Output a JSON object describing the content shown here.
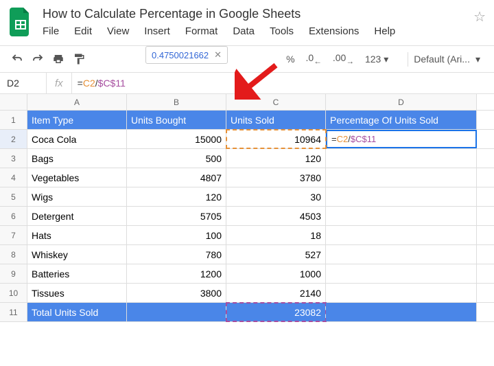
{
  "doc_title": "How to Calculate Percentage in Google Sheets",
  "menu": {
    "file": "File",
    "edit": "Edit",
    "view": "View",
    "insert": "Insert",
    "format": "Format",
    "data": "Data",
    "tools": "Tools",
    "extensions": "Extensions",
    "help": "Help"
  },
  "tooltip_value": "0.4750021662",
  "toolbar": {
    "percent": "%",
    "dec_dec": ".0",
    "inc_dec": ".00",
    "num_fmt": "123",
    "font": "Default (Ari..."
  },
  "active_cell": "D2",
  "fx_label": "fx",
  "formula": {
    "eq": "=",
    "ref1": "C2",
    "op": "/",
    "ref2": "$C$11"
  },
  "cols": {
    "A": "A",
    "B": "B",
    "C": "C",
    "D": "D"
  },
  "headers": {
    "item": "Item Type",
    "bought": "Units Bought",
    "sold": "Units Sold",
    "pct": "Percentage Of Units Sold"
  },
  "rows": [
    {
      "n": "2",
      "item": "Coca Cola",
      "bought": "15000",
      "sold": "10964"
    },
    {
      "n": "3",
      "item": "Bags",
      "bought": "500",
      "sold": "120"
    },
    {
      "n": "4",
      "item": "Vegetables",
      "bought": "4807",
      "sold": "3780"
    },
    {
      "n": "5",
      "item": "Wigs",
      "bought": "120",
      "sold": "30"
    },
    {
      "n": "6",
      "item": "Detergent",
      "bought": "5705",
      "sold": "4503"
    },
    {
      "n": "7",
      "item": "Hats",
      "bought": "100",
      "sold": "18"
    },
    {
      "n": "8",
      "item": "Whiskey",
      "bought": "780",
      "sold": "527"
    },
    {
      "n": "9",
      "item": "Batteries",
      "bought": "1200",
      "sold": "1000"
    },
    {
      "n": "10",
      "item": "Tissues",
      "bought": "3800",
      "sold": "2140"
    }
  ],
  "total": {
    "n": "11",
    "label": "Total Units Sold",
    "sold": "23082"
  },
  "chart_data": {
    "type": "table",
    "title": "How to Calculate Percentage in Google Sheets",
    "columns": [
      "Item Type",
      "Units Bought",
      "Units Sold",
      "Percentage Of Units Sold"
    ],
    "rows": [
      [
        "Coca Cola",
        15000,
        10964,
        0.4750021662
      ],
      [
        "Bags",
        500,
        120,
        null
      ],
      [
        "Vegetables",
        4807,
        3780,
        null
      ],
      [
        "Wigs",
        120,
        30,
        null
      ],
      [
        "Detergent",
        5705,
        4503,
        null
      ],
      [
        "Hats",
        100,
        18,
        null
      ],
      [
        "Whiskey",
        780,
        527,
        null
      ],
      [
        "Batteries",
        1200,
        1000,
        null
      ],
      [
        "Tissues",
        3800,
        2140,
        null
      ],
      [
        "Total Units Sold",
        null,
        23082,
        null
      ]
    ],
    "formula": "=C2/$C$11"
  }
}
